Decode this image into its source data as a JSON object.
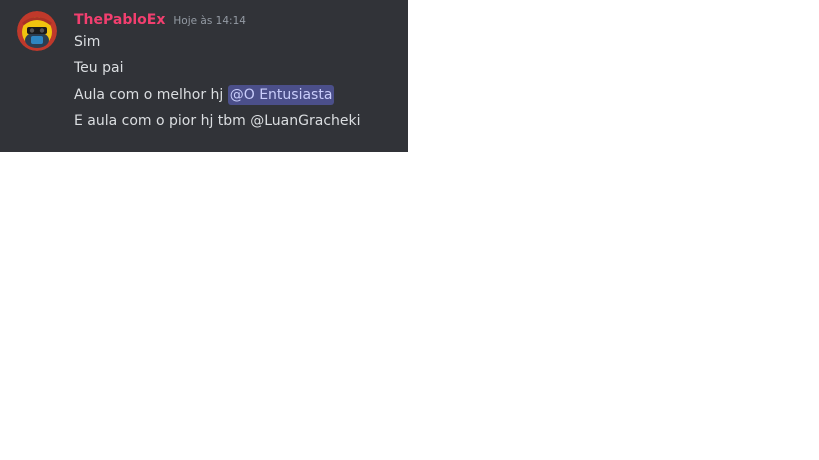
{
  "colors": {
    "panel_background": "#313338",
    "username_color": "#f23f6f",
    "message_text": "#dbdee1",
    "timestamp_text": "#949ba4",
    "mention_background": "#4b4f8a",
    "mention_text": "#c9cdfb"
  },
  "message": {
    "avatar_icon": "avatar-icon",
    "username": "ThePabloEx",
    "timestamp": "Hoje às 14:14",
    "lines": [
      {
        "text": "Sim"
      },
      {
        "text": "Teu pai"
      },
      {
        "text": "Aula com o melhor hj ",
        "mention": "@O Entusiasta"
      },
      {
        "text": "E aula com o pior hj tbm @LuanGracheki"
      }
    ]
  }
}
